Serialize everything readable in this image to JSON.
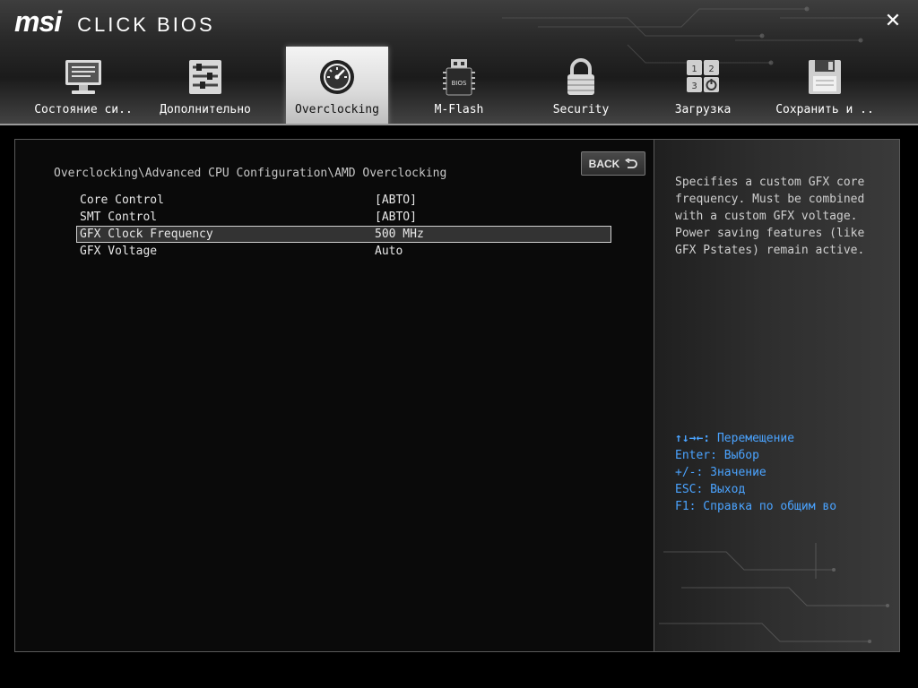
{
  "app": {
    "logo_main": "msi",
    "logo_sub": "CLICK BIOS",
    "close_glyph": "✕"
  },
  "tabs": [
    {
      "label": "Состояние си..",
      "icon": "monitor-icon",
      "active": false
    },
    {
      "label": "Дополнительно",
      "icon": "sliders-icon",
      "active": false
    },
    {
      "label": "Overclocking",
      "icon": "speedometer-icon",
      "active": true
    },
    {
      "label": "M-Flash",
      "icon": "usb-bios-icon",
      "active": false
    },
    {
      "label": "Security",
      "icon": "padlock-icon",
      "active": false
    },
    {
      "label": "Загрузка",
      "icon": "boot-order-icon",
      "active": false
    },
    {
      "label": "Сохранить и ..",
      "icon": "floppy-disk-icon",
      "active": false
    }
  ],
  "main": {
    "breadcrumb": "Overclocking\\Advanced CPU Configuration\\AMD Overclocking",
    "back_label": "BACK",
    "settings": [
      {
        "name": "Core Control",
        "value": "[АВТО]"
      },
      {
        "name": "SMT Control",
        "value": "[АВТО]"
      },
      {
        "name": "GFX Clock Frequency",
        "value": "500 MHz",
        "selected": true
      },
      {
        "name": "GFX Voltage",
        "value": "Auto"
      }
    ]
  },
  "help": {
    "lines": [
      "Specifies a custom GFX core",
      "frequency. Must be combined",
      "with a custom GFX voltage.",
      "Power saving features (like",
      "GFX Pstates) remain active."
    ],
    "keys": [
      {
        "key": "↑↓→←:",
        "desc": " Перемещение"
      },
      {
        "key": "Enter:",
        "desc": " Выбор"
      },
      {
        "key": "+/-:",
        "desc": " Значение"
      },
      {
        "key": "ESC:",
        "desc": " Выход"
      },
      {
        "key": "F1:",
        "desc": " Справка по общим во"
      }
    ]
  },
  "colors": {
    "accent": "#4aa3ff",
    "background": "#0a0a0a",
    "header": "#2a2a2a"
  }
}
